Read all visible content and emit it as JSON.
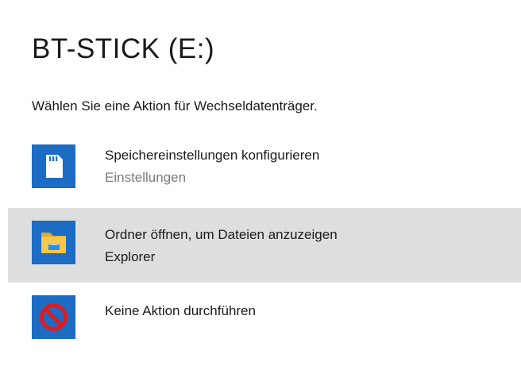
{
  "dialog": {
    "title": "BT-STICK (E:)",
    "prompt": "Wählen Sie eine Aktion für Wechseldatenträger."
  },
  "options": [
    {
      "icon": "sd-card-icon",
      "label": "Speichereinstellungen konfigurieren",
      "sublabel": "Einstellungen",
      "selected": false
    },
    {
      "icon": "folder-explorer-icon",
      "label": "Ordner öffnen, um Dateien anzuzeigen",
      "sublabel": "Explorer",
      "selected": true
    },
    {
      "icon": "no-action-icon",
      "label": "Keine Aktion durchführen",
      "selected": false
    }
  ],
  "colors": {
    "tile_blue": "#1c6cc4",
    "selected_background": "#dedede",
    "folder_yellow": "#f5c74a",
    "no_action_red": "#d81e24"
  }
}
